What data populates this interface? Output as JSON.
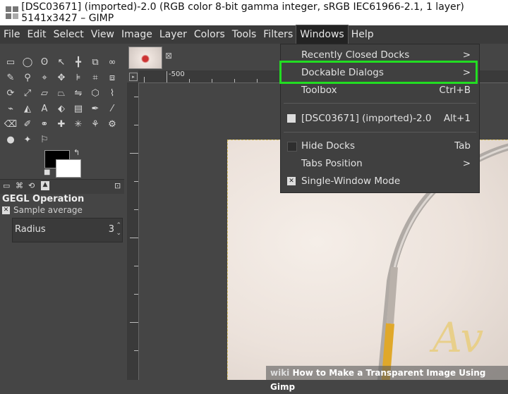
{
  "window": {
    "title": "[DSC03671] (imported)-2.0 (RGB color 8-bit gamma integer, sRGB IEC61966-2.1, 1 layer) 5141x3427 – GIMP"
  },
  "menubar": {
    "items": [
      "File",
      "Edit",
      "Select",
      "View",
      "Image",
      "Layer",
      "Colors",
      "Tools",
      "Filters",
      "Windows",
      "Help"
    ],
    "active": "Windows"
  },
  "windows_menu": {
    "items": [
      {
        "label": "Recently Closed Docks",
        "accel": ">"
      },
      {
        "label": "Dockable Dialogs",
        "accel": ">"
      },
      {
        "label": "Toolbox",
        "accel": "Ctrl+B"
      },
      {
        "label": "[DSC03671] (imported)-2.0",
        "accel": "Alt+1"
      },
      {
        "label": "Hide Docks",
        "accel": "Tab"
      },
      {
        "label": "Tabs Position",
        "accel": ">"
      },
      {
        "label": "Single-Window Mode",
        "accel": ""
      }
    ],
    "highlighted": "Dockable Dialogs"
  },
  "tool_options": {
    "title": "GEGL Operation",
    "sample_average_label": "Sample average",
    "radius_label": "Radius",
    "radius_value": "3"
  },
  "ruler": {
    "h_labels": [
      "-500"
    ]
  },
  "canvas": {
    "text_fragment": "Av"
  },
  "watermark": {
    "brand": "wiki",
    "caption": "How to Make a Transparent Image Using Gimp"
  },
  "colors": {
    "highlight_box": "#22dd22",
    "foreground": "#000000",
    "background": "#ffffff",
    "ring_gold": "#e0a82a"
  }
}
